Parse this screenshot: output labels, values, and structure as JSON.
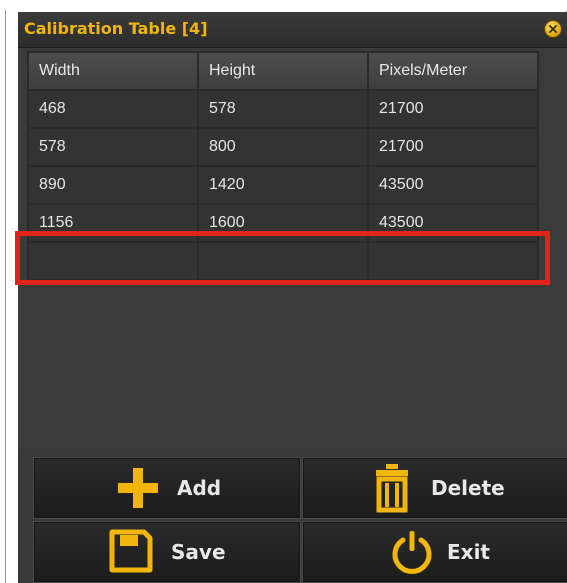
{
  "window": {
    "title": "Calibration Table [4]"
  },
  "table": {
    "columns": [
      "Width",
      "Height",
      "Pixels/Meter"
    ],
    "rows": [
      [
        "468",
        "578",
        "21700"
      ],
      [
        "578",
        "800",
        "21700"
      ],
      [
        "890",
        "1420",
        "43500"
      ],
      [
        "1156",
        "1600",
        "43500"
      ],
      [
        "",
        "",
        ""
      ]
    ]
  },
  "buttons": {
    "add": "Add",
    "delete": "Delete",
    "save": "Save",
    "exit": "Exit"
  },
  "icons": {
    "close": "close-icon",
    "add": "plus-icon",
    "delete": "trash-icon",
    "save": "floppy-disk-icon",
    "exit": "power-icon"
  },
  "colors": {
    "accent": "#f2b50c",
    "highlight": "#e2231a",
    "panel": "#3a3a3a",
    "cell": "#333333"
  }
}
